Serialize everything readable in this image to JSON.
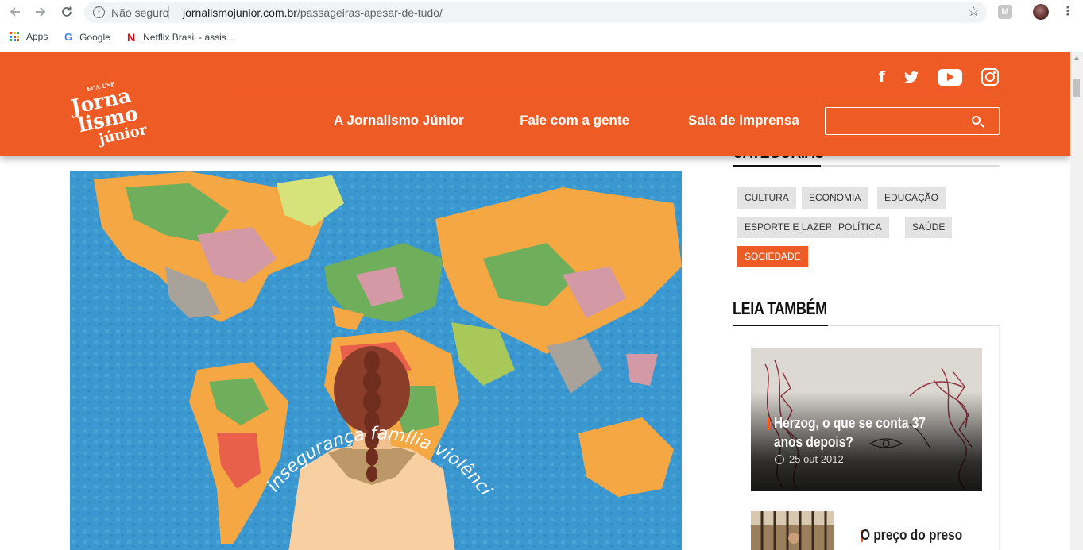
{
  "browser": {
    "security_label": "Não seguro",
    "url_host": "jornalismojunior.com.br",
    "url_path": "/passageiras-apesar-de-tudo/",
    "extension_label": "M",
    "bookmarks": [
      {
        "label": "Apps",
        "icon": "apps-grid-icon"
      },
      {
        "label": "Google",
        "icon": "google-logo-icon"
      },
      {
        "label": "Netflix Brasil - assis...",
        "icon": "netflix-logo-icon"
      }
    ]
  },
  "header": {
    "logo_text_top": "ECA-USP",
    "logo_text_main_1": "Jorna",
    "logo_text_main_2": "lismo",
    "logo_text_main_3": "júnior",
    "nav": [
      {
        "label": "A Jornalismo Júnior"
      },
      {
        "label": "Fale com a gente"
      },
      {
        "label": "Sala de imprensa"
      }
    ],
    "search": {
      "placeholder": "",
      "value": ""
    },
    "social": [
      "facebook-icon",
      "twitter-icon",
      "youtube-icon",
      "instagram-icon"
    ],
    "brand_color": "#ef5b25"
  },
  "hero": {
    "arc_words": "insegurança família violência medo assédio solidão machismo"
  },
  "sidebar": {
    "categories_title": "CATEGORIAS",
    "tags": [
      {
        "label": "CULTURA",
        "active": false
      },
      {
        "label": "ECONOMIA",
        "active": false
      },
      {
        "label": "EDUCAÇÃO",
        "active": false
      },
      {
        "label": "ESPORTE E LAZER",
        "active": false
      },
      {
        "label": "POLÍTICA",
        "active": false
      },
      {
        "label": "SAÚDE",
        "active": false
      },
      {
        "label": "SOCIEDADE",
        "active": true
      }
    ],
    "related_title": "LEIA TAMBÉM",
    "related": [
      {
        "title": "Herzog, o que se conta 37 anos depois?",
        "date": "25 out 2012"
      },
      {
        "title": "O preço do preso"
      }
    ]
  }
}
